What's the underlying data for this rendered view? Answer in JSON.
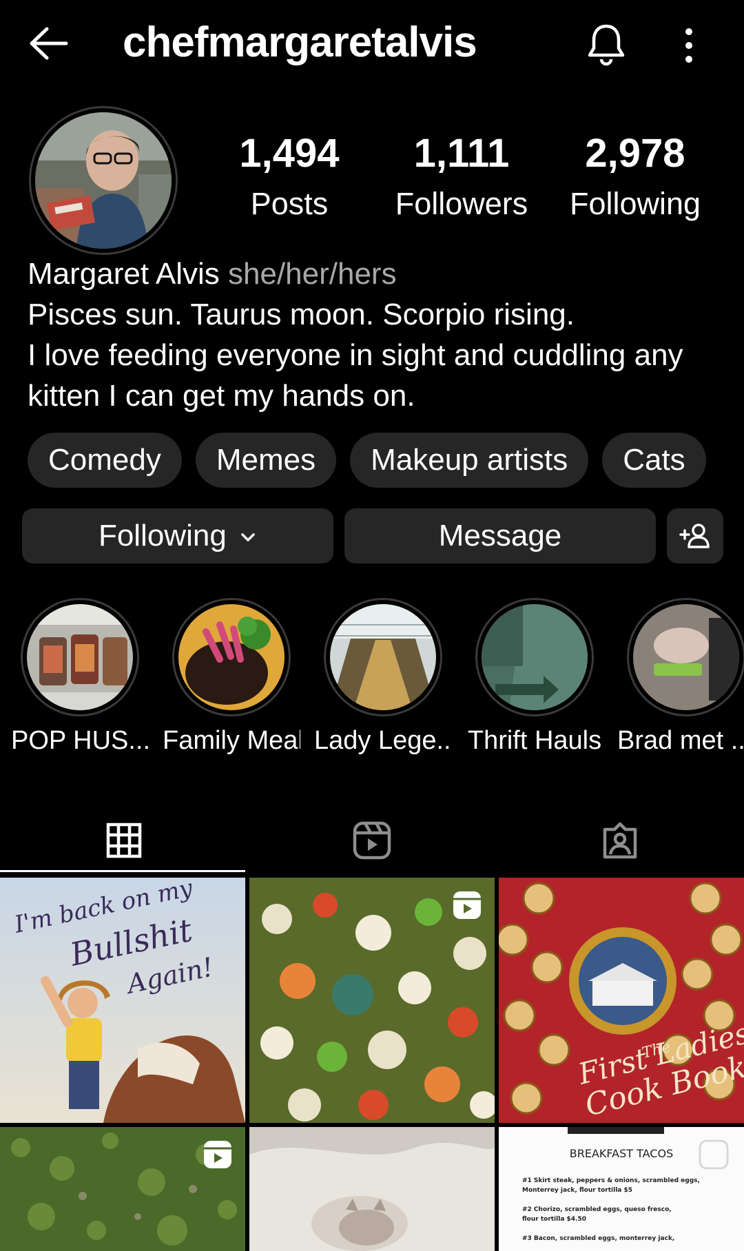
{
  "header": {
    "username": "chefmargaretalvis"
  },
  "stats": [
    {
      "value": "1,494",
      "label": "Posts"
    },
    {
      "value": "1,111",
      "label": "Followers"
    },
    {
      "value": "2,978",
      "label": "Following"
    }
  ],
  "bio": {
    "name": "Margaret Alvis",
    "pronouns": "she/her/hers",
    "line1": "Pisces sun. Taurus moon. Scorpio rising.",
    "line2": "I love feeding everyone in sight and cuddling any",
    "line3": "kitten I can get my hands on."
  },
  "chips": [
    "Comedy",
    "Memes",
    "Makeup artists",
    "Cats"
  ],
  "actions": {
    "following": "Following",
    "message": "Message"
  },
  "highlights": [
    {
      "label": "POP HUS..."
    },
    {
      "label": "Family Meal"
    },
    {
      "label": "Lady Lege..."
    },
    {
      "label": "Thrift Hauls"
    },
    {
      "label": "Brad met ..."
    }
  ],
  "posts": {
    "p1": {
      "line1": "I'm back on my",
      "line2": "Bullshit",
      "line3": "Again!"
    },
    "p3": {
      "line1": "The",
      "line2": "First Ladies",
      "line3": "Cook Book"
    },
    "p6": {
      "title": "BREAKFAST TACOS",
      "item1a": "#1 Skirt steak, peppers & onions, scrambled eggs,",
      "item1b": "Monterrey jack, flour tortilla $5",
      "item2a": "#2 Chorizo, scrambled eggs, queso fresco,",
      "item2b": "flour tortilla $4.50",
      "item3a": "#3 Bacon, scrambled eggs, monterrey jack,"
    }
  },
  "colors": {
    "background": "#000000",
    "button": "#262626",
    "muted": "#a8a8a8"
  },
  "icons": [
    "back-arrow-icon",
    "bell-icon",
    "more-vertical-icon",
    "chevron-down-icon",
    "add-person-icon",
    "grid-icon",
    "reels-icon",
    "tagged-icon",
    "reel-badge-icon"
  ]
}
